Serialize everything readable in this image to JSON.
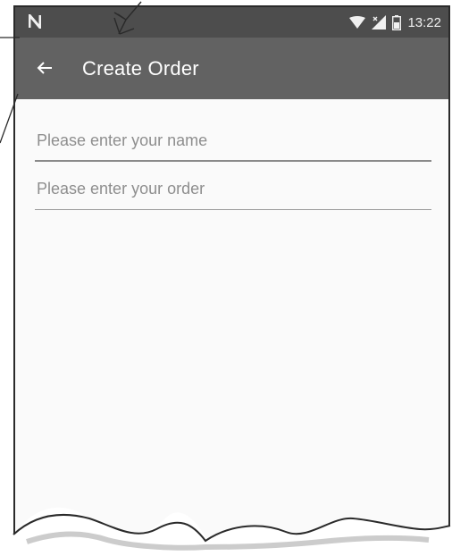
{
  "status_bar": {
    "time": "13:22",
    "icons": [
      "notification-n-icon",
      "wifi-icon",
      "cell-signal-icon",
      "battery-icon"
    ]
  },
  "app_bar": {
    "title": "Create Order",
    "back_icon": "back-arrow-icon"
  },
  "form": {
    "name_field": {
      "value": "",
      "placeholder": "Please enter your name"
    },
    "order_field": {
      "value": "",
      "placeholder": "Please enter your order"
    }
  },
  "colors": {
    "status_bar": "#4d4d4d",
    "app_bar": "#626262",
    "background": "#fafafa"
  }
}
